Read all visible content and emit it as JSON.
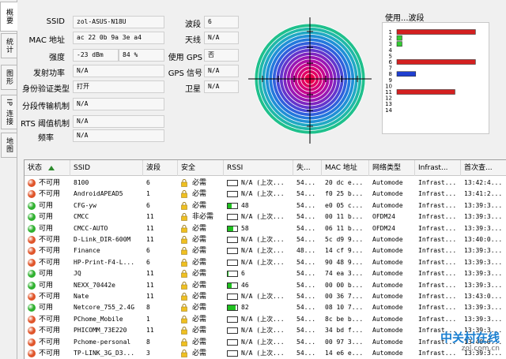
{
  "tabs": [
    "概要",
    "统计",
    "图形",
    "IP 连接",
    "地图"
  ],
  "info_left": [
    {
      "label": "SSID",
      "value": "zol-ASUS-N18U"
    },
    {
      "label": "MAC 地址",
      "value": "ac 22 0b 9a 3e a4"
    },
    {
      "label": "强度",
      "value": "-23 dBm",
      "value2": "84 %"
    },
    {
      "label": "发射功率",
      "value": "N/A"
    },
    {
      "label": "身份验证类型",
      "value": "打开"
    },
    {
      "label": "分段传输机制",
      "value": "N/A"
    },
    {
      "label": "RTS 阈值机制",
      "value": "N/A"
    },
    {
      "label": "频率",
      "value": "N/A"
    }
  ],
  "info_right": [
    {
      "label": "波段",
      "value": "6"
    },
    {
      "label": "天线",
      "value": "N/A"
    },
    {
      "label": "使用 GPS",
      "value": "否"
    },
    {
      "label": "GPS 信号",
      "value": "N/A"
    },
    {
      "label": "卫星",
      "value": "N/A"
    }
  ],
  "usage_chart": {
    "title": "使用...波段",
    "channels": [
      "1",
      "2",
      "3",
      "4",
      "5",
      "6",
      "7",
      "8",
      "9",
      "10",
      "11",
      "12",
      "13",
      "14"
    ],
    "bars": [
      {
        "channel": 1,
        "value": 0.92,
        "color": "#d42020"
      },
      {
        "channel": 2,
        "value": 0.06,
        "color": "#33cc33"
      },
      {
        "channel": 3,
        "value": 0.06,
        "color": "#33cc33"
      },
      {
        "channel": 6,
        "value": 0.92,
        "color": "#d42020"
      },
      {
        "channel": 8,
        "value": 0.22,
        "color": "#1f3fd0"
      },
      {
        "channel": 11,
        "value": 0.68,
        "color": "#d42020"
      }
    ]
  },
  "table": {
    "headers": [
      "状态",
      "SSID",
      "波段",
      "安全",
      "RSSI",
      "失...",
      "MAC 地址",
      "网络类型",
      "Infrast...",
      "首次查..."
    ],
    "rows": [
      {
        "status": "不可用",
        "dot": "red",
        "ssid": "8100",
        "ch": "6",
        "sec": "必需",
        "rssi": "N/A",
        "rssi_note": "(上次...",
        "rssi_level": 0,
        "loss": "54...",
        "mac": "20 dc e...",
        "net": "Automode",
        "infra": "Infrast...",
        "first": "13:42:4..."
      },
      {
        "status": "不可用",
        "dot": "red",
        "ssid": "AndroidAPEAD5",
        "ch": "1",
        "sec": "必需",
        "rssi": "N/A",
        "rssi_note": "(上次...",
        "rssi_level": 0,
        "loss": "54...",
        "mac": "f0 25 b...",
        "net": "Automode",
        "infra": "Infrast...",
        "first": "13:41:2..."
      },
      {
        "status": "可用",
        "dot": "green",
        "ssid": "CFG-yw",
        "ch": "6",
        "sec": "必需",
        "rssi": "48",
        "rssi_note": "",
        "rssi_level": 0.45,
        "loss": "54...",
        "mac": "e0 05 c...",
        "net": "Automode",
        "infra": "Infrast...",
        "first": "13:39:3..."
      },
      {
        "status": "可用",
        "dot": "green",
        "ssid": "CMCC",
        "ch": "11",
        "sec": "非必需",
        "rssi": "N/A",
        "rssi_note": "(上次...",
        "rssi_level": 0,
        "loss": "54...",
        "mac": "00 11 b...",
        "net": "OFDM24",
        "infra": "Infrast...",
        "first": "13:39:3..."
      },
      {
        "status": "可用",
        "dot": "green",
        "ssid": "CMCC-AUTO",
        "ch": "11",
        "sec": "必需",
        "rssi": "58",
        "rssi_note": "",
        "rssi_level": 0.6,
        "loss": "54...",
        "mac": "06 11 b...",
        "net": "OFDM24",
        "infra": "Infrast...",
        "first": "13:39:3..."
      },
      {
        "status": "不可用",
        "dot": "red",
        "ssid": "D-Link_DIR-600M",
        "ch": "11",
        "sec": "必需",
        "rssi": "N/A",
        "rssi_note": "(上次...",
        "rssi_level": 0,
        "loss": "54...",
        "mac": "5c d9 9...",
        "net": "Automode",
        "infra": "Infrast...",
        "first": "13:40:0..."
      },
      {
        "status": "不可用",
        "dot": "red",
        "ssid": "Finance",
        "ch": "6",
        "sec": "必需",
        "rssi": "N/A",
        "rssi_note": "(上次...",
        "rssi_level": 0,
        "loss": "48...",
        "mac": "14 cf 9...",
        "net": "Automode",
        "infra": "Infrast...",
        "first": "13:39:3..."
      },
      {
        "status": "不可用",
        "dot": "red",
        "ssid": "HP-Print-F4-L...",
        "ch": "6",
        "sec": "必需",
        "rssi": "N/A",
        "rssi_note": "(上次...",
        "rssi_level": 0,
        "loss": "54...",
        "mac": "90 48 9...",
        "net": "Automode",
        "infra": "Infrast...",
        "first": "13:39:3..."
      },
      {
        "status": "可用",
        "dot": "green",
        "ssid": "JQ",
        "ch": "11",
        "sec": "必需",
        "rssi": "6",
        "rssi_note": "",
        "rssi_level": 0.05,
        "loss": "54...",
        "mac": "74 ea 3...",
        "net": "Automode",
        "infra": "Infrast...",
        "first": "13:39:3..."
      },
      {
        "status": "可用",
        "dot": "green",
        "ssid": "NEXX_70442e",
        "ch": "11",
        "sec": "必需",
        "rssi": "46",
        "rssi_note": "",
        "rssi_level": 0.45,
        "loss": "54...",
        "mac": "00 00 b...",
        "net": "Automode",
        "infra": "Infrast...",
        "first": "13:39:3..."
      },
      {
        "status": "不可用",
        "dot": "red",
        "ssid": "Nate",
        "ch": "11",
        "sec": "必需",
        "rssi": "N/A",
        "rssi_note": "(上次...",
        "rssi_level": 0,
        "loss": "54...",
        "mac": "00 36 7...",
        "net": "Automode",
        "infra": "Infrast...",
        "first": "13:43:0..."
      },
      {
        "status": "可用",
        "dot": "green",
        "ssid": "Netcore_755_2.4G",
        "ch": "8",
        "sec": "必需",
        "rssi": "82",
        "rssi_note": "",
        "rssi_level": 0.82,
        "loss": "54...",
        "mac": "08 10 7...",
        "net": "Automode",
        "infra": "Infrast...",
        "first": "13:39:3..."
      },
      {
        "status": "不可用",
        "dot": "red",
        "ssid": "PChome_Mobile",
        "ch": "1",
        "sec": "必需",
        "rssi": "N/A",
        "rssi_note": "(上次...",
        "rssi_level": 0,
        "loss": "54...",
        "mac": "8c be b...",
        "net": "Automode",
        "infra": "Infrast...",
        "first": "13:39:3..."
      },
      {
        "status": "不可用",
        "dot": "red",
        "ssid": "PHICOMM_73E220",
        "ch": "11",
        "sec": "必需",
        "rssi": "N/A",
        "rssi_note": "(上次...",
        "rssi_level": 0,
        "loss": "54...",
        "mac": "34 bd f...",
        "net": "Automode",
        "infra": "Infrast...",
        "first": "13:39:3..."
      },
      {
        "status": "不可用",
        "dot": "red",
        "ssid": "Pchome-personal",
        "ch": "8",
        "sec": "必需",
        "rssi": "N/A",
        "rssi_note": "(上次...",
        "rssi_level": 0,
        "loss": "54...",
        "mac": "00 97 3...",
        "net": "Automode",
        "infra": "Infrast...",
        "first": "13:40:0..."
      },
      {
        "status": "不可用",
        "dot": "red",
        "ssid": "TP-LINK_3G_D3...",
        "ch": "3",
        "sec": "必需",
        "rssi": "N/A",
        "rssi_note": "(上次...",
        "rssi_level": 0,
        "loss": "54...",
        "mac": "14 e6 e...",
        "net": "Automode",
        "infra": "Infrast...",
        "first": "13:39:3..."
      }
    ]
  },
  "watermark": {
    "main": "中关村在线",
    "sub": "zol.com.cn"
  },
  "colors": {
    "red_dot": "#e0552a",
    "green_dot": "#2fb12f"
  }
}
